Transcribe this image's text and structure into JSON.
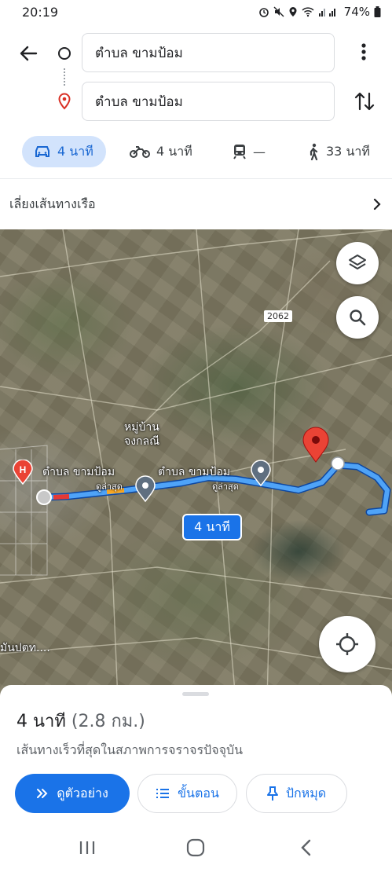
{
  "status": {
    "time": "20:19",
    "battery": "74%"
  },
  "directions": {
    "origin": "ตำบล ขามป้อม",
    "destination": "ตำบล ขามป้อม"
  },
  "modes": [
    {
      "name": "drive",
      "value": "4 นาที",
      "selected": true
    },
    {
      "name": "motorcycle",
      "value": "4 นาที"
    },
    {
      "name": "transit",
      "value": "—"
    },
    {
      "name": "walk",
      "value": "33 นาที"
    }
  ],
  "options": {
    "avoid_ferries": "เลี่ยงเส้นทางเรือ"
  },
  "map": {
    "road_number": "2062",
    "labels": {
      "village": "หมู่บ้าน\nจงกลณี",
      "place_left": "ตำบล ขามป้อม",
      "place_left_sub": "ดูล่าสุด",
      "place_right": "ตำบล ขามป้อม",
      "place_right_sub": "ดูล่าสุด",
      "edge_text": "มันปตท...."
    },
    "duration_chip": "4 นาที",
    "route_color": "#1a73e8"
  },
  "sheet": {
    "duration": "4 นาที",
    "distance": "(2.8 กม.)",
    "description": "เส้นทางเร็วที่สุดในสภาพการจราจรปัจจุบัน",
    "buttons": {
      "preview": "ดูตัวอย่าง",
      "steps": "ขั้นตอน",
      "pin": "ปักหมุด"
    }
  }
}
